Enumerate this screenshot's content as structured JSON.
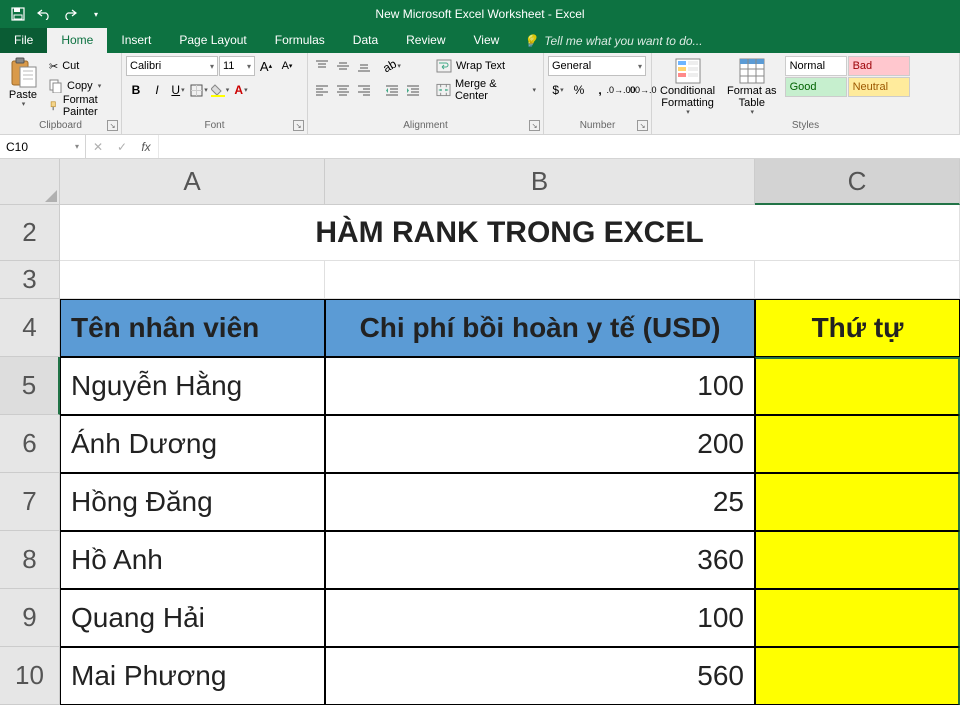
{
  "app": {
    "title": "New Microsoft Excel Worksheet - Excel"
  },
  "tabs": {
    "file": "File",
    "home": "Home",
    "insert": "Insert",
    "pagelayout": "Page Layout",
    "formulas": "Formulas",
    "data": "Data",
    "review": "Review",
    "view": "View",
    "tellme": "Tell me what you want to do..."
  },
  "ribbon": {
    "clipboard": {
      "label": "Clipboard",
      "paste": "Paste",
      "cut": "Cut",
      "copy": "Copy",
      "formatpainter": "Format Painter"
    },
    "font": {
      "label": "Font",
      "name": "Calibri",
      "size": "11"
    },
    "alignment": {
      "label": "Alignment",
      "wrap": "Wrap Text",
      "merge": "Merge & Center"
    },
    "number": {
      "label": "Number",
      "format": "General"
    },
    "styles": {
      "label": "Styles",
      "conditional": "Conditional Formatting",
      "formatastable": "Format as Table",
      "normal": "Normal",
      "bad": "Bad",
      "good": "Good",
      "neutral": "Neutral"
    }
  },
  "namebox": "C10",
  "formula": "",
  "columns": [
    "A",
    "B",
    "C"
  ],
  "rows": [
    "2",
    "3",
    "4",
    "5",
    "6",
    "7",
    "8",
    "9",
    "10"
  ],
  "data": {
    "title": "HÀM RANK TRONG EXCEL",
    "headers": {
      "a": "Tên nhân viên",
      "b": "Chi phí bồi hoàn y tế (USD)",
      "c": "Thứ tự"
    },
    "rows": [
      {
        "a": "Nguyễn Hằng",
        "b": "100"
      },
      {
        "a": "Ánh Dương",
        "b": "200"
      },
      {
        "a": "Hồng Đăng",
        "b": "25"
      },
      {
        "a": "Hồ Anh",
        "b": "360"
      },
      {
        "a": "Quang Hải",
        "b": "100"
      },
      {
        "a": "Mai Phương",
        "b": "560"
      }
    ]
  }
}
